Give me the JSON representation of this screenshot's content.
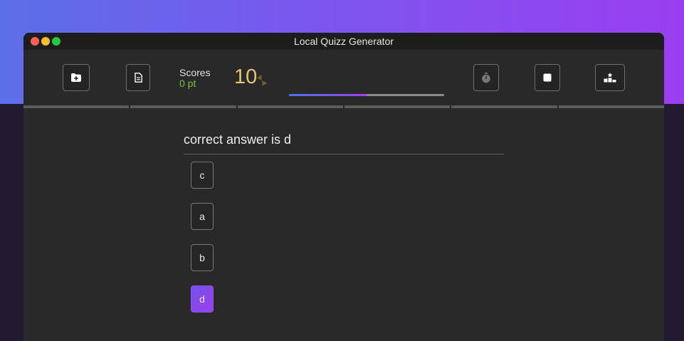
{
  "window": {
    "title": "Local Quizz Generator"
  },
  "toolbar": {
    "buttons": [
      {
        "name": "open-folder-button",
        "icon": "folder-plus-icon"
      },
      {
        "name": "document-button",
        "icon": "document-icon"
      },
      {
        "name": "stopwatch-button",
        "icon": "stopwatch-icon"
      },
      {
        "name": "stop-button",
        "icon": "stop-icon"
      },
      {
        "name": "leaderboard-button",
        "icon": "podium-icon"
      }
    ],
    "scores_label": "Scores",
    "scores_value": "0 pt",
    "timer_value": "10",
    "timer_icon": "hourglass-icon",
    "progress": 0.5
  },
  "progress_segments": 6,
  "question": {
    "text": "correct answer is d",
    "answers": [
      {
        "label": "c",
        "selected": false
      },
      {
        "label": "a",
        "selected": false
      },
      {
        "label": "b",
        "selected": false
      },
      {
        "label": "d",
        "selected": true
      }
    ]
  },
  "colors": {
    "accent": "#9a3ff0",
    "score_green": "#7ec13c",
    "timer_yellow": "#e4c66f"
  }
}
